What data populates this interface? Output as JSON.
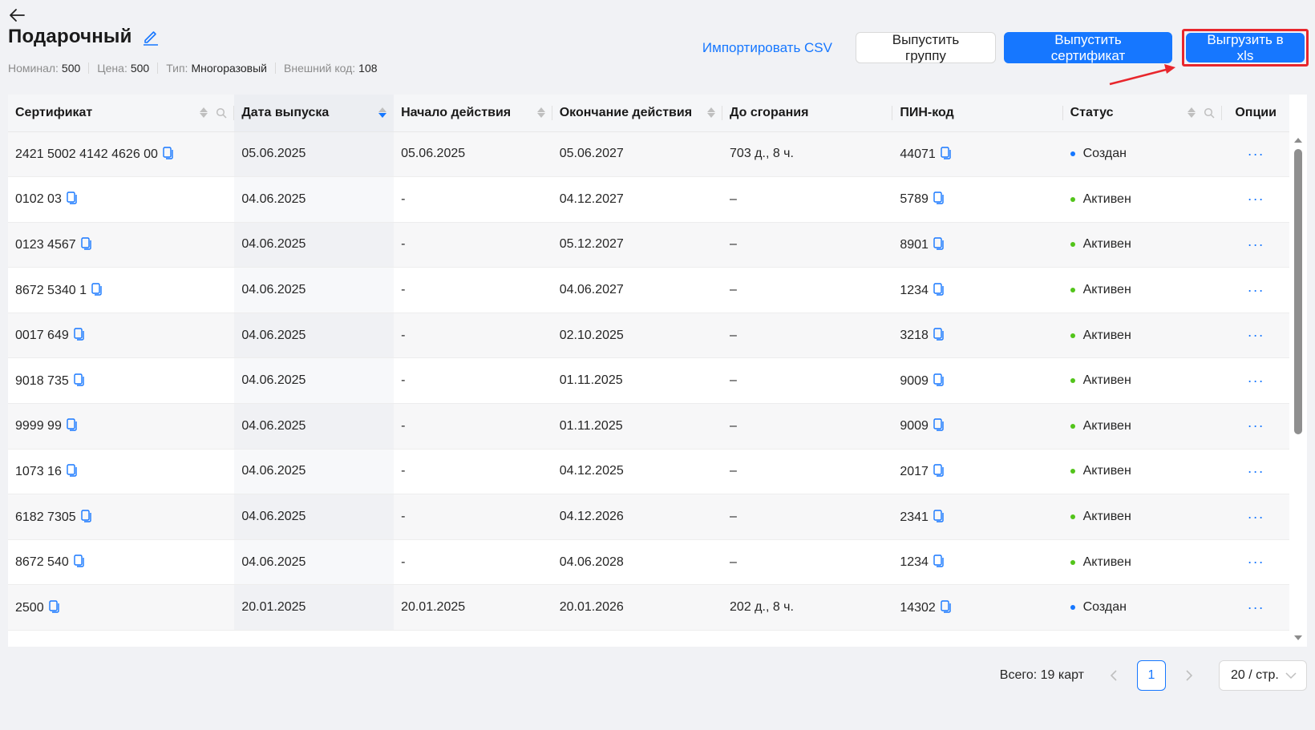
{
  "header": {
    "title": "Подарочный",
    "meta": [
      {
        "label": "Номинал:",
        "value": "500"
      },
      {
        "label": "Цена:",
        "value": "500"
      },
      {
        "label": "Тип:",
        "value": "Многоразовый"
      },
      {
        "label": "Внешний код:",
        "value": "108"
      }
    ]
  },
  "actions": {
    "import_csv": "Импортировать CSV",
    "issue_group": "Выпустить группу",
    "issue_certificate": "Выпустить сертификат",
    "export_xls": "Выгрузить в xls"
  },
  "colors": {
    "primary": "#1677ff",
    "active": "#52c41a",
    "created": "#1677ff",
    "highlight": "#e8262c"
  },
  "table": {
    "columns": {
      "certificate": "Сертификат",
      "issue_date": "Дата выпуска",
      "start": "Начало действия",
      "end": "Окончание действия",
      "burn": "До сгорания",
      "pin": "ПИН-код",
      "status": "Статус",
      "options": "Опции"
    },
    "options_glyph": "···",
    "rows": [
      {
        "cert": "2421 5002 4142 4626 00",
        "issued": "05.06.2025",
        "start": "05.06.2025",
        "end": "05.06.2027",
        "burn": "703 д., 8 ч.",
        "pin": "44071",
        "status": "Создан",
        "status_type": "created"
      },
      {
        "cert": "0102 03",
        "issued": "04.06.2025",
        "start": "-",
        "end": "04.12.2027",
        "burn": "–",
        "pin": "5789",
        "status": "Активен",
        "status_type": "active"
      },
      {
        "cert": "0123 4567",
        "issued": "04.06.2025",
        "start": "-",
        "end": "05.12.2027",
        "burn": "–",
        "pin": "8901",
        "status": "Активен",
        "status_type": "active"
      },
      {
        "cert": "8672 5340 1",
        "issued": "04.06.2025",
        "start": "-",
        "end": "04.06.2027",
        "burn": "–",
        "pin": "1234",
        "status": "Активен",
        "status_type": "active"
      },
      {
        "cert": "0017 649",
        "issued": "04.06.2025",
        "start": "-",
        "end": "02.10.2025",
        "burn": "–",
        "pin": "3218",
        "status": "Активен",
        "status_type": "active"
      },
      {
        "cert": "9018 735",
        "issued": "04.06.2025",
        "start": "-",
        "end": "01.11.2025",
        "burn": "–",
        "pin": "9009",
        "status": "Активен",
        "status_type": "active"
      },
      {
        "cert": "9999 99",
        "issued": "04.06.2025",
        "start": "-",
        "end": "01.11.2025",
        "burn": "–",
        "pin": "9009",
        "status": "Активен",
        "status_type": "active"
      },
      {
        "cert": "1073 16",
        "issued": "04.06.2025",
        "start": "-",
        "end": "04.12.2025",
        "burn": "–",
        "pin": "2017",
        "status": "Активен",
        "status_type": "active"
      },
      {
        "cert": "6182 7305",
        "issued": "04.06.2025",
        "start": "-",
        "end": "04.12.2026",
        "burn": "–",
        "pin": "2341",
        "status": "Активен",
        "status_type": "active"
      },
      {
        "cert": "8672 540",
        "issued": "04.06.2025",
        "start": "-",
        "end": "04.06.2028",
        "burn": "–",
        "pin": "1234",
        "status": "Активен",
        "status_type": "active"
      },
      {
        "cert": "2500",
        "issued": "20.01.2025",
        "start": "20.01.2025",
        "end": "20.01.2026",
        "burn": "202 д., 8 ч.",
        "pin": "14302",
        "status": "Создан",
        "status_type": "created"
      }
    ]
  },
  "pagination": {
    "total": "Всего: 19 карт",
    "current_page": "1",
    "page_size": "20 / стр."
  }
}
